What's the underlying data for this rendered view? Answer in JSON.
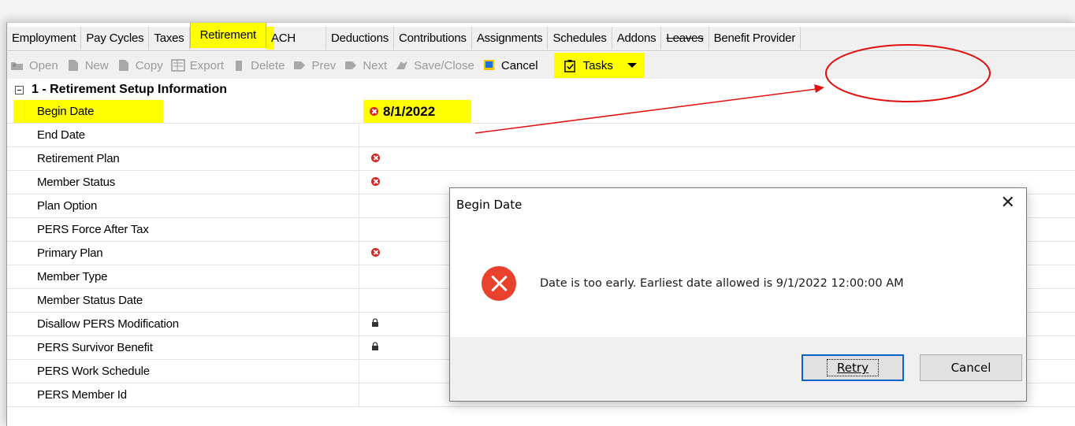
{
  "tabs": [
    {
      "label": "Employment"
    },
    {
      "label": "Pay Cycles"
    },
    {
      "label": "Taxes"
    },
    {
      "label": "Retirement"
    },
    {
      "label": "ACH"
    },
    {
      "label": "Deductions"
    },
    {
      "label": "Contributions"
    },
    {
      "label": "Assignments"
    },
    {
      "label": "Schedules"
    },
    {
      "label": "Addons"
    },
    {
      "label": "Leaves"
    },
    {
      "label": "Benefit Provider"
    }
  ],
  "toolbar": {
    "open": "Open",
    "new": "New",
    "copy": "Copy",
    "export": "Export",
    "delete": "Delete",
    "prev": "Prev",
    "next": "Next",
    "save_close": "Save/Close",
    "cancel": "Cancel",
    "tasks": "Tasks"
  },
  "section": {
    "title": "1 - Retirement Setup Information"
  },
  "rows": [
    {
      "label": "Begin Date",
      "value": "8/1/2022"
    },
    {
      "label": "End Date"
    },
    {
      "label": "Retirement Plan"
    },
    {
      "label": "Member Status"
    },
    {
      "label": "Plan Option"
    },
    {
      "label": "PERS Force After Tax"
    },
    {
      "label": "Primary Plan"
    },
    {
      "label": "Member Type"
    },
    {
      "label": "Member Status Date"
    },
    {
      "label": "Disallow PERS Modification"
    },
    {
      "label": "PERS Survivor Benefit"
    },
    {
      "label": "PERS Work Schedule"
    },
    {
      "label": "PERS Member Id"
    }
  ],
  "dialog": {
    "title": "Begin Date",
    "close": "✕",
    "message": "Date is too early. Earliest date allowed is 9/1/2022 12:00:00 AM",
    "retry": "Retry",
    "cancel": "Cancel"
  },
  "colors": {
    "highlight": "#ffff00",
    "error": "#d9231f",
    "annotation": "#e01010"
  }
}
